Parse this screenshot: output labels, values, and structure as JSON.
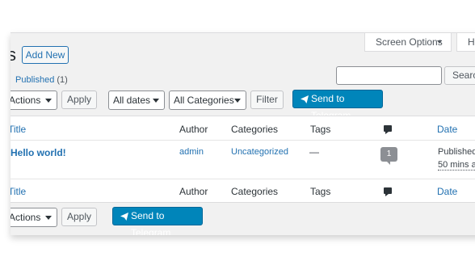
{
  "screen_tabs": {
    "screen_options": "Screen Options",
    "help": "H"
  },
  "page_title_fragment": "s",
  "add_new": "Add New",
  "subsubsub": {
    "published": "Published",
    "published_count": "(1)"
  },
  "search": {
    "button": "Searc",
    "value": ""
  },
  "tablenav_top": {
    "bulk_action": "Actions",
    "apply": "Apply",
    "dates": "All dates",
    "categories": "All Categories",
    "filter": "Filter",
    "telegram": "Send to Telegram"
  },
  "columns": {
    "title": "Title",
    "author": "Author",
    "categories": "Categories",
    "tags": "Tags",
    "comments_icon": "comment-icon",
    "date": "Date"
  },
  "rows": [
    {
      "title": "Hello world!",
      "author": "admin",
      "categories": "Uncategorized",
      "tags": "—",
      "comments": "1",
      "date_status": "Published",
      "date_value": "50 mins a"
    }
  ],
  "tablenav_bottom": {
    "bulk_action": "Actions",
    "apply": "Apply",
    "telegram": "Send to Telegram"
  },
  "colors": {
    "link": "#2271b1",
    "primary_button": "#0085ba",
    "background": "#f1f1f1"
  }
}
